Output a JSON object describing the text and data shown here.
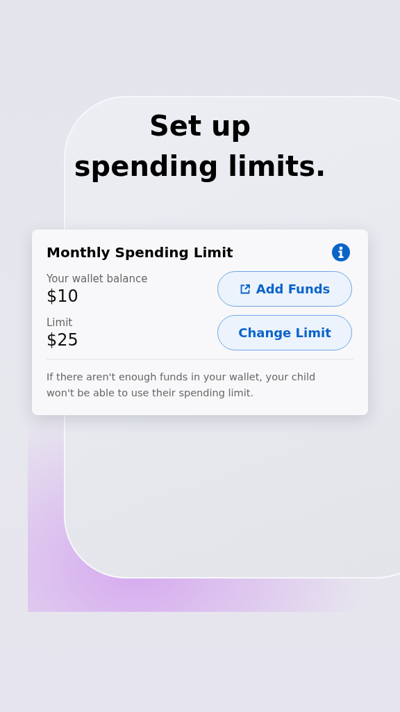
{
  "headline_lines": [
    "Set up",
    "spending limits."
  ],
  "card": {
    "title": "Monthly Spending Limit",
    "rows": [
      {
        "label": "Your wallet balance",
        "value": "$10",
        "button": {
          "label": "Add Funds",
          "kind": "external"
        }
      },
      {
        "label": "Limit",
        "value": "$25",
        "button": {
          "label": "Change Limit",
          "kind": "plain"
        }
      }
    ],
    "note": "If there aren't enough funds in your wallet, your child won't be able to use their spending limit."
  }
}
